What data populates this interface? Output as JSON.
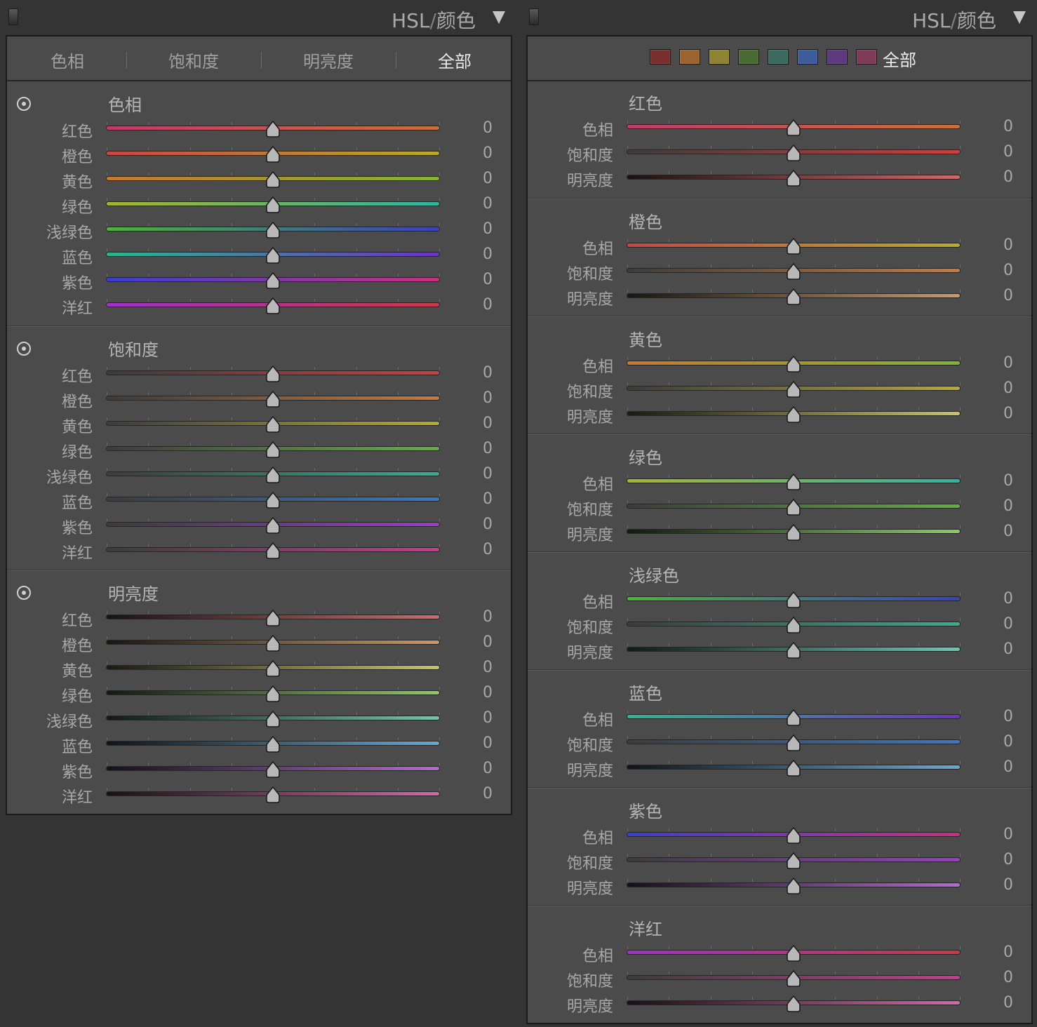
{
  "left_panel": {
    "title_main": "HSL",
    "title_slash": "/",
    "title_rest": "颜色",
    "tabs": [
      "色相",
      "饱和度",
      "明亮度",
      "全部"
    ],
    "active_tab": 3,
    "sections": [
      {
        "title": "色相",
        "rows": [
          {
            "label": "红色",
            "value": "0",
            "left": "#c13a6a",
            "right": "#c8703a"
          },
          {
            "label": "橙色",
            "value": "0",
            "left": "#c84646",
            "right": "#b8ab2a"
          },
          {
            "label": "黄色",
            "value": "0",
            "left": "#c8782e",
            "right": "#82b432"
          },
          {
            "label": "绿色",
            "value": "0",
            "left": "#a6b42e",
            "right": "#2eb4a0"
          },
          {
            "label": "浅绿色",
            "value": "0",
            "left": "#4cb43a",
            "right": "#3a42bc"
          },
          {
            "label": "蓝色",
            "value": "0",
            "left": "#2eb48e",
            "right": "#6a34c0"
          },
          {
            "label": "紫色",
            "value": "0",
            "left": "#3a3ed0",
            "right": "#c83080"
          },
          {
            "label": "洋红",
            "value": "0",
            "left": "#a030c8",
            "right": "#c83a48"
          }
        ]
      },
      {
        "title": "饱和度",
        "rows": [
          {
            "label": "红色",
            "value": "0",
            "left": "#3c3c3c",
            "right": "#cc4040"
          },
          {
            "label": "橙色",
            "value": "0",
            "left": "#3c3c3c",
            "right": "#c87a3c"
          },
          {
            "label": "黄色",
            "value": "0",
            "left": "#3c3c3c",
            "right": "#b6aa36"
          },
          {
            "label": "绿色",
            "value": "0",
            "left": "#3c3c3c",
            "right": "#62b040"
          },
          {
            "label": "浅绿色",
            "value": "0",
            "left": "#3c3c3c",
            "right": "#36ae92"
          },
          {
            "label": "蓝色",
            "value": "0",
            "left": "#3c3c3c",
            "right": "#3a78c4"
          },
          {
            "label": "紫色",
            "value": "0",
            "left": "#3c3c3c",
            "right": "#9a3ccc"
          },
          {
            "label": "洋红",
            "value": "0",
            "left": "#3c3c3c",
            "right": "#c83a90"
          }
        ]
      },
      {
        "title": "明亮度",
        "rows": [
          {
            "label": "红色",
            "value": "0",
            "left": "#1a1212",
            "right": "#d06a6a"
          },
          {
            "label": "橙色",
            "value": "0",
            "left": "#1a1612",
            "right": "#c89a6a"
          },
          {
            "label": "黄色",
            "value": "0",
            "left": "#1a1a10",
            "right": "#c8c26a"
          },
          {
            "label": "绿色",
            "value": "0",
            "left": "#121a10",
            "right": "#8ec86a"
          },
          {
            "label": "浅绿色",
            "value": "0",
            "left": "#101a18",
            "right": "#6ac8b4"
          },
          {
            "label": "蓝色",
            "value": "0",
            "left": "#10141a",
            "right": "#6aa8d0"
          },
          {
            "label": "紫色",
            "value": "0",
            "left": "#16101a",
            "right": "#b46ad0"
          },
          {
            "label": "洋红",
            "value": "0",
            "left": "#1a1016",
            "right": "#d06aa8"
          }
        ]
      }
    ]
  },
  "right_panel": {
    "title_main": "HSL",
    "title_slash": "/",
    "title_rest": "颜色",
    "swatches": [
      "#7a2e2e",
      "#9a6430",
      "#8e8432",
      "#4a6a34",
      "#3c6a60",
      "#3c5c9c",
      "#5e3a7e",
      "#7e3a56"
    ],
    "swatch_all_label": "全部",
    "groups": [
      {
        "title": "红色",
        "rows": [
          {
            "label": "色相",
            "value": "0",
            "left": "#c13a6a",
            "right": "#c8703a"
          },
          {
            "label": "饱和度",
            "value": "0",
            "left": "#3c3c3c",
            "right": "#cc4040"
          },
          {
            "label": "明亮度",
            "value": "0",
            "left": "#1a1212",
            "right": "#d06a6a"
          }
        ]
      },
      {
        "title": "橙色",
        "rows": [
          {
            "label": "色相",
            "value": "0",
            "left": "#c84646",
            "right": "#b8ab2a"
          },
          {
            "label": "饱和度",
            "value": "0",
            "left": "#3c3c3c",
            "right": "#c87a3c"
          },
          {
            "label": "明亮度",
            "value": "0",
            "left": "#1a1612",
            "right": "#c89a6a"
          }
        ]
      },
      {
        "title": "黄色",
        "rows": [
          {
            "label": "色相",
            "value": "0",
            "left": "#c8782e",
            "right": "#82b432"
          },
          {
            "label": "饱和度",
            "value": "0",
            "left": "#3c3c3c",
            "right": "#b6aa36"
          },
          {
            "label": "明亮度",
            "value": "0",
            "left": "#1a1a10",
            "right": "#c8c26a"
          }
        ]
      },
      {
        "title": "绿色",
        "rows": [
          {
            "label": "色相",
            "value": "0",
            "left": "#a6b42e",
            "right": "#2eb4a0"
          },
          {
            "label": "饱和度",
            "value": "0",
            "left": "#3c3c3c",
            "right": "#62b040"
          },
          {
            "label": "明亮度",
            "value": "0",
            "left": "#121a10",
            "right": "#8ec86a"
          }
        ]
      },
      {
        "title": "浅绿色",
        "rows": [
          {
            "label": "色相",
            "value": "0",
            "left": "#4cb43a",
            "right": "#3a42bc"
          },
          {
            "label": "饱和度",
            "value": "0",
            "left": "#3c3c3c",
            "right": "#36ae92"
          },
          {
            "label": "明亮度",
            "value": "0",
            "left": "#101a18",
            "right": "#6ac8b4"
          }
        ]
      },
      {
        "title": "蓝色",
        "rows": [
          {
            "label": "色相",
            "value": "0",
            "left": "#2eb48e",
            "right": "#6a34c0"
          },
          {
            "label": "饱和度",
            "value": "0",
            "left": "#3c3c3c",
            "right": "#3a78c4"
          },
          {
            "label": "明亮度",
            "value": "0",
            "left": "#10141a",
            "right": "#6aa8d0"
          }
        ]
      },
      {
        "title": "紫色",
        "rows": [
          {
            "label": "色相",
            "value": "0",
            "left": "#3a3ed0",
            "right": "#c83080"
          },
          {
            "label": "饱和度",
            "value": "0",
            "left": "#3c3c3c",
            "right": "#9a3ccc"
          },
          {
            "label": "明亮度",
            "value": "0",
            "left": "#16101a",
            "right": "#b46ad0"
          }
        ]
      },
      {
        "title": "洋红",
        "rows": [
          {
            "label": "色相",
            "value": "0",
            "left": "#a030c8",
            "right": "#c83a48"
          },
          {
            "label": "饱和度",
            "value": "0",
            "left": "#3c3c3c",
            "right": "#c83a90"
          },
          {
            "label": "明亮度",
            "value": "0",
            "left": "#1a1016",
            "right": "#d06aa8"
          }
        ]
      }
    ]
  }
}
